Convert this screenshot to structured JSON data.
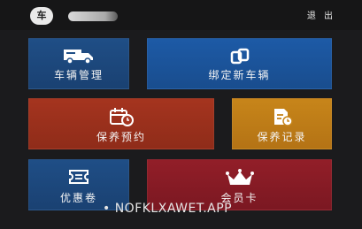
{
  "header": {
    "avatar_text": "车",
    "logout_label": "退 出"
  },
  "tiles": {
    "vehicle_management": {
      "label": "车辆管理",
      "icon": "truck-icon",
      "color": "#1f4e86"
    },
    "bind_vehicle": {
      "label": "绑定新车辆",
      "icon": "link-icon",
      "color": "#1d5aa6"
    },
    "maintenance_booking": {
      "label": "保养预约",
      "icon": "calendar-clock-icon",
      "color": "#a5341f"
    },
    "maintenance_records": {
      "label": "保养记录",
      "icon": "record-icon",
      "color": "#c7851a"
    },
    "coupons": {
      "label": "优惠卷",
      "icon": "ticket-icon",
      "color": "#1f4e86"
    },
    "membership_card": {
      "label": "会员卡",
      "icon": "crown-icon",
      "color": "#921e28"
    }
  },
  "watermark": "• NOFKLXAWET.APP"
}
